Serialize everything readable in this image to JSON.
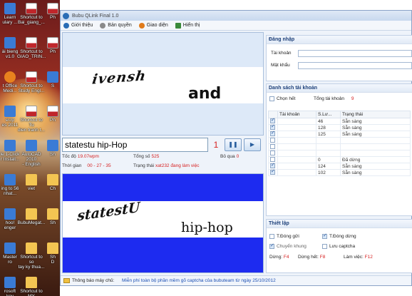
{
  "desktop_icons": [
    {
      "label": "Learn\nulary ...",
      "kind": "app"
    },
    {
      "label": "Shortcut to\nBai_giang_...",
      "kind": "pdf"
    },
    {
      "label": "Ph",
      "kind": "pdf"
    },
    {
      "label": "ài bieng\nv1.0",
      "kind": "app"
    },
    {
      "label": "Shortcut to\nGIAO_TRIN...",
      "kind": "pdf"
    },
    {
      "label": "Ph",
      "kind": "pdf"
    },
    {
      "label": "t Office\nMedi...",
      "kind": "media"
    },
    {
      "label": "Shortcut to\nStudy Engl...",
      "kind": "pdf"
    },
    {
      "label": "S",
      "kind": "app"
    },
    {
      "label": "eUp\nes 2011",
      "kind": "app"
    },
    {
      "label": "Shortcut to Tu\ndien tranh t...",
      "kind": "pdf"
    },
    {
      "label": "Ph",
      "kind": "pdf"
    },
    {
      "label": "le 1-Click\nr Install...",
      "kind": "app"
    },
    {
      "label": "AutoCAD 2010\n- English",
      "kind": "app"
    },
    {
      "label": "Sh",
      "kind": "app"
    },
    {
      "label": "ing to 56\nnhat...",
      "kind": "app"
    },
    {
      "label": "viet",
      "kind": "folder"
    },
    {
      "label": "Ch",
      "kind": "folder"
    },
    {
      "label": "hoo!\nenger",
      "kind": "app"
    },
    {
      "label": "BubuMegat...",
      "kind": "folder"
    },
    {
      "label": "Sh",
      "kind": "folder"
    },
    {
      "label": "Master\nro",
      "kind": "app"
    },
    {
      "label": "Shortcut to so\ntay ky thua...",
      "kind": "folder"
    },
    {
      "label": "Sh\nD",
      "kind": "folder"
    },
    {
      "label": "rosoft\nkey",
      "kind": "app"
    },
    {
      "label": "Shortcut to MY\nbook ...\ncompressed",
      "kind": "folder"
    }
  ],
  "app": {
    "title": "Bubu QLink Final 1.0",
    "menu": [
      {
        "label": "Giới thiệu",
        "icon": "info-icon",
        "color": "#2a6db5"
      },
      {
        "label": "Bản quyền",
        "icon": "key-icon",
        "color": "#8a8a8a"
      },
      {
        "label": "Giao diện",
        "icon": "palette-icon",
        "color": "#e07b1a"
      },
      {
        "label": "Hiển thị",
        "icon": "display-icon",
        "color": "#3a8a3a"
      }
    ]
  },
  "captcha": {
    "word1": "ivensh",
    "word2": "and"
  },
  "answer": {
    "value": "statestu hip-Hop",
    "counter": "1"
  },
  "stats": {
    "speed_label": "Tốc độ",
    "speed_value": "19.07wpm",
    "total_label": "Tổng số",
    "total_value": "525",
    "skip_label": "Bỏ qua",
    "skip_value": "0",
    "time_label": "Thời gian",
    "time_value": "00 - 27 - 35",
    "status_label": "Trạng thái",
    "status_value": "xat232 đang làm việc"
  },
  "preview": {
    "word1": "statestU",
    "word2": "hip-hop"
  },
  "status_bar": {
    "label": "Thông báo máy chủ:",
    "message": "Miễn phí toàn bộ phần mềm gõ captcha của bubuteam từ ngày 25/10/2012"
  },
  "login": {
    "title": "Đăng nhập",
    "user_label": "Tài khoản",
    "pass_label": "Mật khẩu"
  },
  "accounts": {
    "title": "Danh sách tài khoản",
    "select_all": "Chọn hết",
    "total_label": "Tổng tài khoản",
    "total_value": "9",
    "columns": [
      "Tài khoản",
      "S.Lư...",
      "Trạng thái"
    ],
    "rows": [
      {
        "checked": true,
        "count": "46",
        "status": "Sẵn sàng"
      },
      {
        "checked": true,
        "count": "128",
        "status": "Sẵn sàng"
      },
      {
        "checked": true,
        "count": "125",
        "status": "Sẵn sàng"
      },
      {
        "checked": false,
        "count": "",
        "status": ""
      },
      {
        "checked": false,
        "count": "",
        "status": ""
      },
      {
        "checked": false,
        "count": "",
        "status": ""
      },
      {
        "checked": false,
        "count": "0",
        "status": "Đã dừng"
      },
      {
        "checked": true,
        "count": "124",
        "status": "Sẵn sàng"
      },
      {
        "checked": true,
        "count": "102",
        "status": "Sẵn sàng"
      }
    ]
  },
  "settings": {
    "title": "Thiết lập",
    "auto_send": "T.Đóng gửi",
    "auto_stop": "T.Đóng dừng",
    "switch_frame": "Chuyển khung",
    "save_captcha": "Lưu captcha",
    "stop_label": "Dừng:",
    "stop_key": "F4",
    "stop_all_label": "Dừng hết:",
    "stop_all_key": "F8",
    "work_label": "Làm việc:",
    "work_key": "F12"
  }
}
